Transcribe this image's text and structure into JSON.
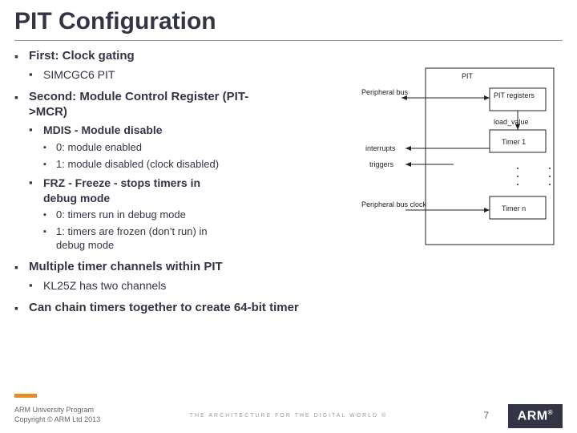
{
  "title": "PIT Configuration",
  "bullets": [
    {
      "text": "First: Clock gating",
      "children": [
        {
          "text": "SIMCGC6 PIT"
        }
      ]
    },
    {
      "text": "Second: Module Control Register (PIT->MCR)",
      "children": [
        {
          "text": "MDIS - Module disable",
          "bold": true,
          "children": [
            {
              "text": "0: module enabled"
            },
            {
              "text": "1: module disabled (clock disabled)"
            }
          ]
        },
        {
          "text": "FRZ - Freeze - stops timers in debug mode",
          "bold": true,
          "children": [
            {
              "text": "0: timers run in debug mode"
            },
            {
              "text": "1: timers are frozen (don’t run) in debug mode"
            }
          ]
        }
      ]
    },
    {
      "text": "Multiple timer channels within PIT",
      "children": [
        {
          "text": "KL25Z has two channels"
        }
      ]
    },
    {
      "text": "Can chain timers together to create 64-bit timer"
    }
  ],
  "diagram": {
    "title": "PIT",
    "labels": {
      "peripheral_bus": "Peripheral bus",
      "pit_registers": "PIT registers",
      "load_value": "load_value",
      "timer1": "Timer 1",
      "timern": "Timer n",
      "interrupts": "interrupts",
      "triggers": "triggers",
      "peripheral_bus_clock": "Peripheral bus clock"
    }
  },
  "footer": {
    "line1": "ARM University Program",
    "line2": "Copyright © ARM Ltd 2013",
    "tagline": "THE ARCHITECTURE FOR THE DIGITAL WORLD ®",
    "page": "7",
    "logo": "ARM"
  }
}
